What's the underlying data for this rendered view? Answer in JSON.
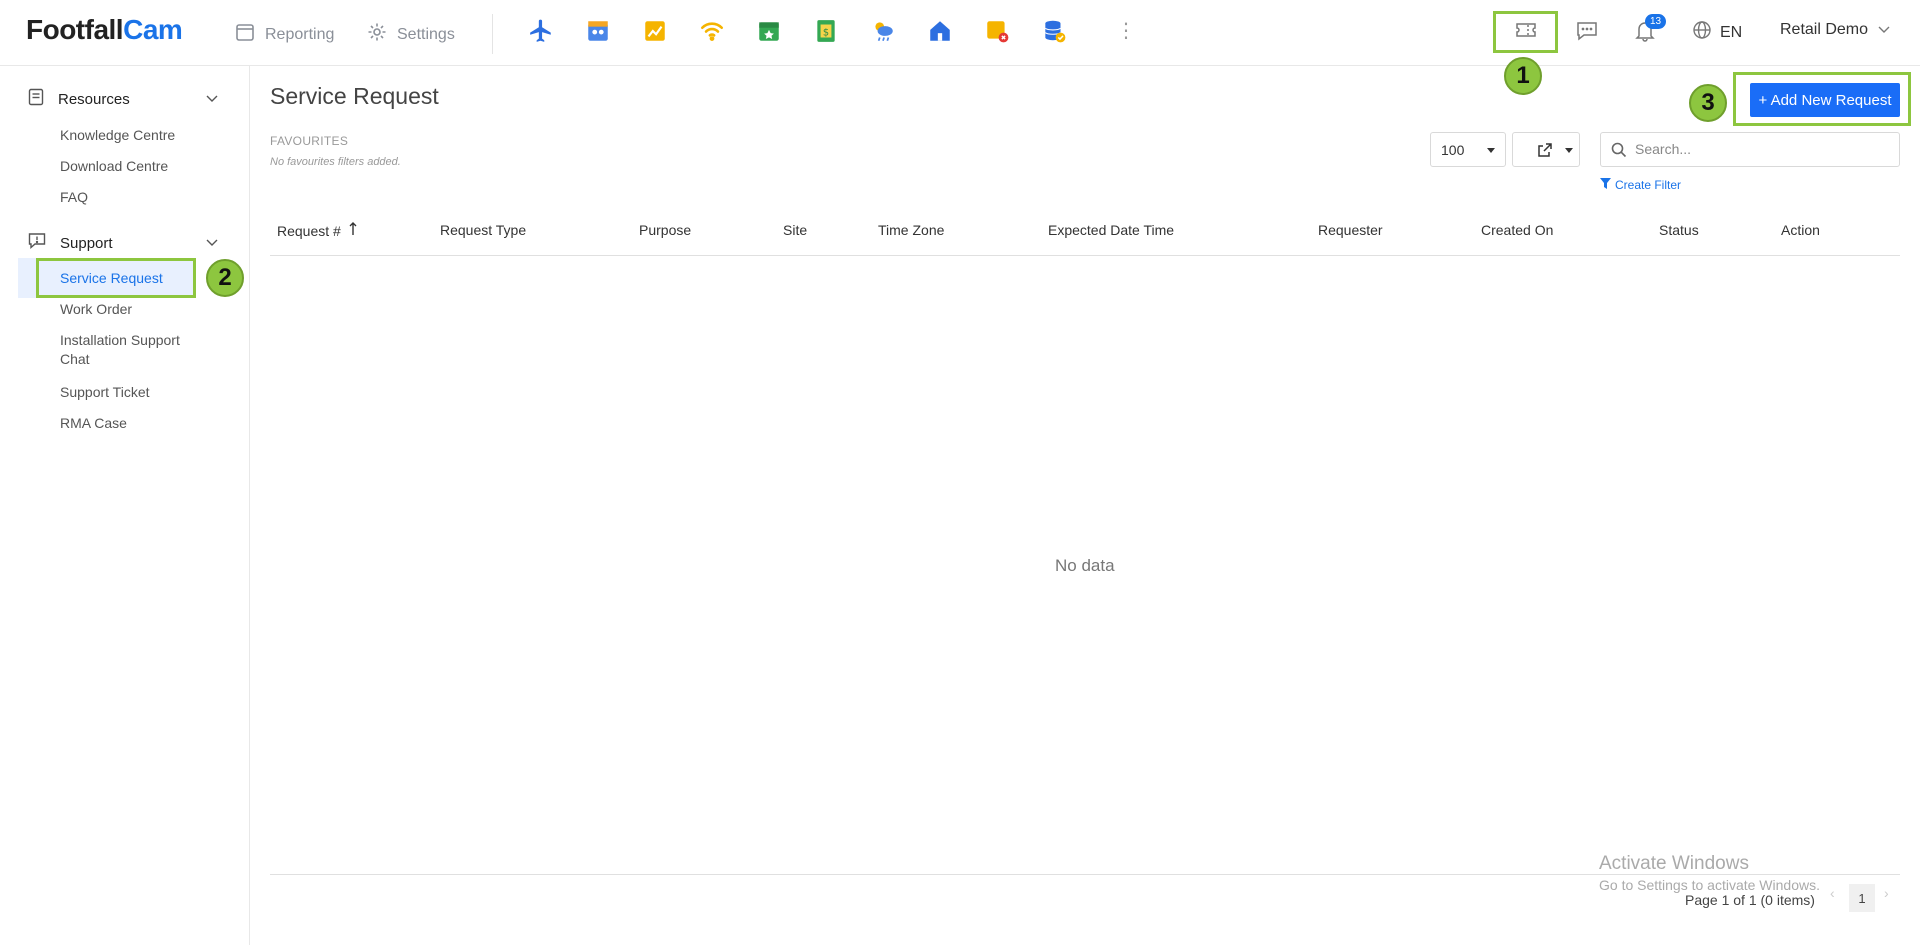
{
  "brand": {
    "part1": "Footfall",
    "part2": "Cam"
  },
  "topnav": {
    "reporting": "Reporting",
    "settings": "Settings"
  },
  "app_icons": [
    "airplane-icon",
    "store-people-icon",
    "chart-up-icon",
    "wifi-icon",
    "calendar-star-icon",
    "money-sheet-icon",
    "weather-icon",
    "home-icon",
    "note-alert-icon",
    "database-check-icon"
  ],
  "header_right": {
    "notifications_count": "13",
    "language": "EN",
    "user": "Retail Demo"
  },
  "callouts": [
    "1",
    "2",
    "3"
  ],
  "sidebar": {
    "resources": {
      "label": "Resources",
      "items": [
        "Knowledge Centre",
        "Download Centre",
        "FAQ"
      ]
    },
    "support": {
      "label": "Support",
      "items": [
        "Service Request",
        "Work Order",
        "Installation Support\nChat",
        "Support Ticket",
        "RMA Case"
      ]
    },
    "active_item": "Service Request"
  },
  "page": {
    "title": "Service Request",
    "favourites_label": "FAVOURITES",
    "favourites_empty": "No favourites filters added.",
    "add_button": "+ Add New Request",
    "page_size": "100",
    "search_placeholder": "Search...",
    "create_filter": "Create Filter"
  },
  "table": {
    "columns": [
      "Request #",
      "Request Type",
      "Purpose",
      "Site",
      "Time Zone",
      "Expected Date Time",
      "Requester",
      "Created On",
      "Status",
      "Action"
    ],
    "sort_column": "Request #",
    "empty_text": "No data",
    "page_info": "Page 1 of 1 (0 items)",
    "current_page": "1"
  },
  "watermark": {
    "line1": "Activate Windows",
    "line2": "Go to Settings to activate Windows."
  },
  "colors": {
    "accent": "#1a6df7",
    "highlight": "#8dc63f",
    "active_bg": "#e8f0fe"
  }
}
